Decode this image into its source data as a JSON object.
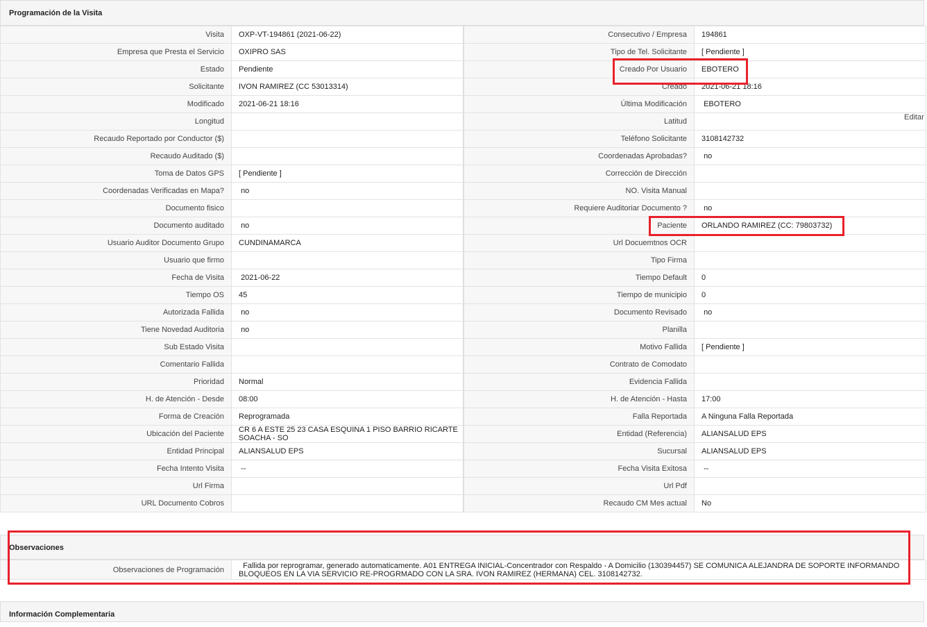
{
  "sections": {
    "programacion": "Programación de la Visita",
    "observaciones": "Observaciones",
    "informacion": "Información Complementaria"
  },
  "edit_link": "Editar",
  "rows": [
    {
      "l1": "Visita",
      "v1": "OXP-VT-194861 (2021-06-22)",
      "l2": "Consecutivo / Empresa",
      "v2": "194861"
    },
    {
      "l1": "Empresa que Presta el Servicio",
      "v1": "OXIPRO SAS",
      "l2": "Tipo de Tel. Solicitante",
      "v2": "[ Pendiente ]"
    },
    {
      "l1": "Estado",
      "v1": "Pendiente",
      "l2": "Creado Por Usuario",
      "v2": "EBOTERO"
    },
    {
      "l1": "Solicitante",
      "v1": "IVON RAMIREZ (CC 53013314)",
      "l2": "Creado",
      "v2": "2021-06-21 18:16"
    },
    {
      "l1": "Modificado",
      "v1": "2021-06-21 18:16",
      "l2": "Última Modificación",
      "v2": " EBOTERO"
    },
    {
      "l1": "Longitud",
      "v1": "",
      "l2": "Latitud",
      "v2": ""
    },
    {
      "l1": "Recaudo Reportado por Conductor ($)",
      "v1": "",
      "l2": "Teléfono Solicitante",
      "v2": "3108142732"
    },
    {
      "l1": "Recaudo Auditado ($)",
      "v1": "",
      "l2": "Coordenadas Aprobadas?",
      "v2": " no"
    },
    {
      "l1": "Toma de Datos GPS",
      "v1": "[ Pendiente ]",
      "l2": "Corrección de Dirección",
      "v2": ""
    },
    {
      "l1": "Coordenadas Verificadas en Mapa?",
      "v1": " no",
      "l2": "NO. Visita Manual",
      "v2": ""
    },
    {
      "l1": "Documento fisico",
      "v1": "",
      "l2": "Requiere Auditoriar Documento ?",
      "v2": " no"
    },
    {
      "l1": "Documento auditado",
      "v1": " no",
      "l2": "Paciente",
      "v2": "ORLANDO RAMIREZ (CC: 79803732)"
    },
    {
      "l1": "Usuario Auditor Documento Grupo",
      "v1": "CUNDINAMARCA",
      "l2": "Url Docuemtnos OCR",
      "v2": ""
    },
    {
      "l1": "Usuario que firmo",
      "v1": "",
      "l2": "Tipo Firma",
      "v2": ""
    },
    {
      "l1": "Fecha de Visita",
      "v1": " 2021-06-22",
      "l2": "Tiempo Default",
      "v2": "0"
    },
    {
      "l1": "Tiempo OS",
      "v1": "45",
      "l2": "Tiempo de municipio",
      "v2": "0"
    },
    {
      "l1": "Autorizada Fallida",
      "v1": " no",
      "l2": "Documento Revisado",
      "v2": " no"
    },
    {
      "l1": "Tiene Novedad Auditoria",
      "v1": " no",
      "l2": "Planilla",
      "v2": ""
    },
    {
      "l1": "Sub Estado Visita",
      "v1": "",
      "l2": "Motivo Fallida",
      "v2": "[ Pendiente ]"
    },
    {
      "l1": "Comentario Fallida",
      "v1": "",
      "l2": "Contrato de Comodato",
      "v2": ""
    },
    {
      "l1": "Prioridad",
      "v1": "Normal",
      "l2": "Evidencia Fallida",
      "v2": ""
    },
    {
      "l1": "H. de Atención - Desde",
      "v1": "08:00",
      "l2": "H. de Atención - Hasta",
      "v2": "17:00"
    },
    {
      "l1": "Forma de Creación",
      "v1": "Reprogramada",
      "l2": "Falla Reportada",
      "v2": "A Ninguna Falla Reportada"
    },
    {
      "l1": "Ubicación del Paciente",
      "v1": "CR 6 A ESTE 25 23 CASA ESQUINA 1 PISO BARRIO RICARTE SOACHA - SO",
      "l2": "Entidad (Referencia)",
      "v2": "ALIANSALUD EPS"
    },
    {
      "l1": "Entidad Principal",
      "v1": "ALIANSALUD EPS",
      "l2": "Sucursal",
      "v2": "ALIANSALUD EPS"
    },
    {
      "l1": "Fecha Intento Visita",
      "v1": " --",
      "l2": "Fecha Visita Exitosa",
      "v2": " --"
    },
    {
      "l1": "Url Firma",
      "v1": "",
      "l2": "Url Pdf",
      "v2": ""
    },
    {
      "l1": "URL Documento Cobros",
      "v1": "",
      "l2": "Recaudo CM Mes actual",
      "v2": "No"
    }
  ],
  "observaciones": {
    "label": "Observaciones de Programación",
    "value": "  Fallida por reprogramar, generado automaticamente. A01 ENTREGA INICIAL-Concentrador con Respaldo - A Domicilio (130394457) SE COMUNICA ALEJANDRA DE SOPORTE INFORMANDO BLOQUEOS EN LA VIA SERVICIO RE-PROGRMADO CON LA SRA. IVON RAMIREZ (HERMANA) CEL. 3108142732."
  },
  "highlight_color": "#e8212b"
}
